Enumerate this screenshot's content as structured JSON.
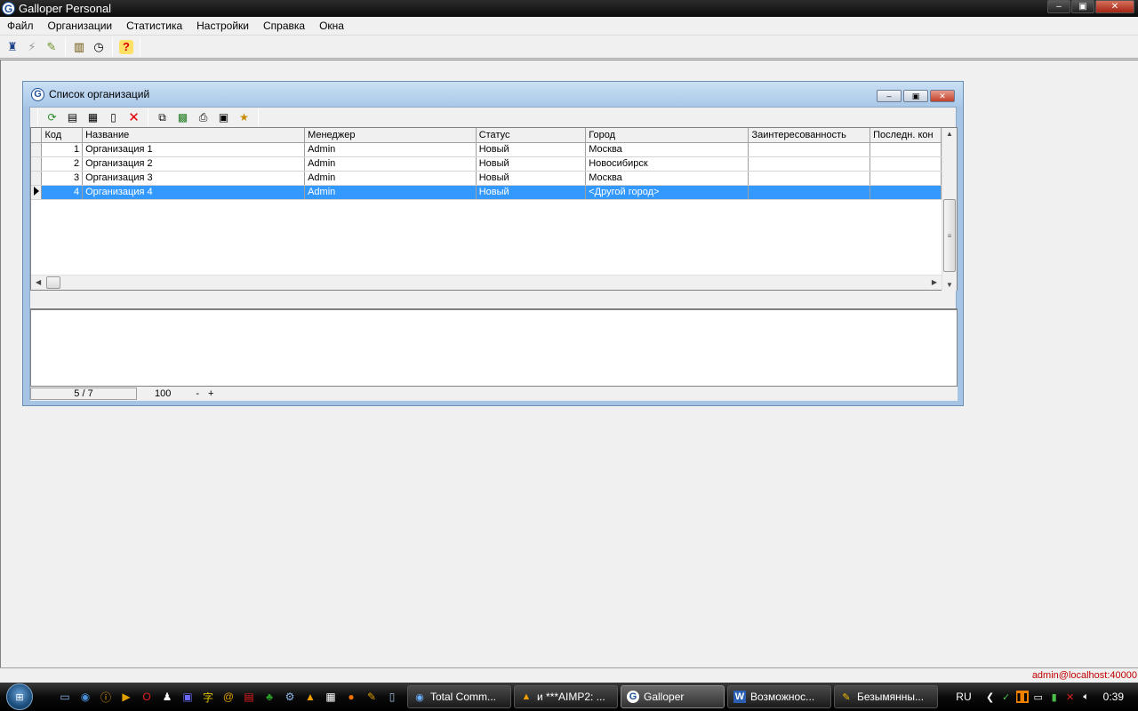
{
  "app": {
    "title": "Galloper Personal",
    "icon_letter": "G"
  },
  "window_controls": {
    "minimize": "‒",
    "maximize": "▣",
    "close": "✕"
  },
  "menu": [
    "Файл",
    "Организации",
    "Статистика",
    "Настройки",
    "Справка",
    "Окна"
  ],
  "main_toolbar": [
    {
      "icon": "connect-icon",
      "glyph": "♜"
    },
    {
      "icon": "disconnect-icon",
      "glyph": "⚡"
    },
    {
      "icon": "plug-icon",
      "glyph": "✎"
    },
    {
      "icon": "factory-icon",
      "glyph": "▥"
    },
    {
      "icon": "clock-icon",
      "glyph": "◷"
    },
    {
      "icon": "help-icon",
      "glyph": "?"
    }
  ],
  "child": {
    "title": "Список организаций",
    "toolbar": [
      {
        "icon": "refresh-icon",
        "glyph": "⟳"
      },
      {
        "icon": "properties-icon",
        "glyph": "▤"
      },
      {
        "icon": "filter-icon",
        "glyph": "▦"
      },
      {
        "icon": "new-document-icon",
        "glyph": "▯"
      },
      {
        "icon": "delete-icon",
        "glyph": "✕"
      },
      {
        "icon": "copy-icon",
        "glyph": "⧉"
      },
      {
        "icon": "excel-icon",
        "glyph": "▩"
      },
      {
        "icon": "print-icon",
        "glyph": "⎙"
      },
      {
        "icon": "export-icon",
        "glyph": "▣"
      },
      {
        "icon": "import-icon",
        "glyph": "★"
      }
    ],
    "columns": [
      "Код",
      "Название",
      "Менеджер",
      "Статус",
      "Город",
      "Заинтересованность",
      "Последн. кон"
    ],
    "rows": [
      {
        "code": "1",
        "name": "Организация 1",
        "manager": "Admin",
        "status": "Новый",
        "city": "Москва",
        "interest": "",
        "last": ""
      },
      {
        "code": "2",
        "name": "Организация 2",
        "manager": "Admin",
        "status": "Новый",
        "city": "Новосибирск",
        "interest": "",
        "last": ""
      },
      {
        "code": "3",
        "name": "Организация 3",
        "manager": "Admin",
        "status": "Новый",
        "city": "Москва",
        "interest": "",
        "last": ""
      },
      {
        "code": "4",
        "name": "Организация 4",
        "manager": "Admin",
        "status": "Новый",
        "city": "<Другой город>",
        "interest": "",
        "last": ""
      }
    ],
    "selected_row": 3,
    "status": {
      "position": "5 / 7",
      "zoom": "100",
      "zoom_minus": "-",
      "zoom_plus": "+"
    }
  },
  "app_status": {
    "user": "admin@localhost:40000"
  },
  "taskbar": {
    "start_label": "⊞",
    "quicklaunch": [
      "desktop-icon",
      "browser-icon",
      "info-icon",
      "media-icon",
      "opera-icon",
      "people-icon",
      "save-icon",
      "font-icon",
      "mail-icon",
      "pdf-icon",
      "app-icon",
      "skype-icon",
      "aimp-icon",
      "calc-icon",
      "firefox-icon",
      "pencil-icon",
      "notes-icon"
    ],
    "tasks": [
      {
        "label": "Total Comm...",
        "icon": "total-commander-icon",
        "glyph": "◉",
        "active": false
      },
      {
        "label": "и ***AIMP2: ...",
        "icon": "aimp-icon",
        "glyph": "▲",
        "active": false
      },
      {
        "label": "Galloper",
        "icon": "galloper-icon",
        "glyph": "G",
        "active": true
      },
      {
        "label": "Возможнос...",
        "icon": "word-icon",
        "glyph": "W",
        "active": false
      },
      {
        "label": "Безымянны...",
        "icon": "paint-icon",
        "glyph": "✎",
        "active": false
      }
    ],
    "tray": {
      "lang": "RU",
      "clock": "0:39"
    }
  }
}
